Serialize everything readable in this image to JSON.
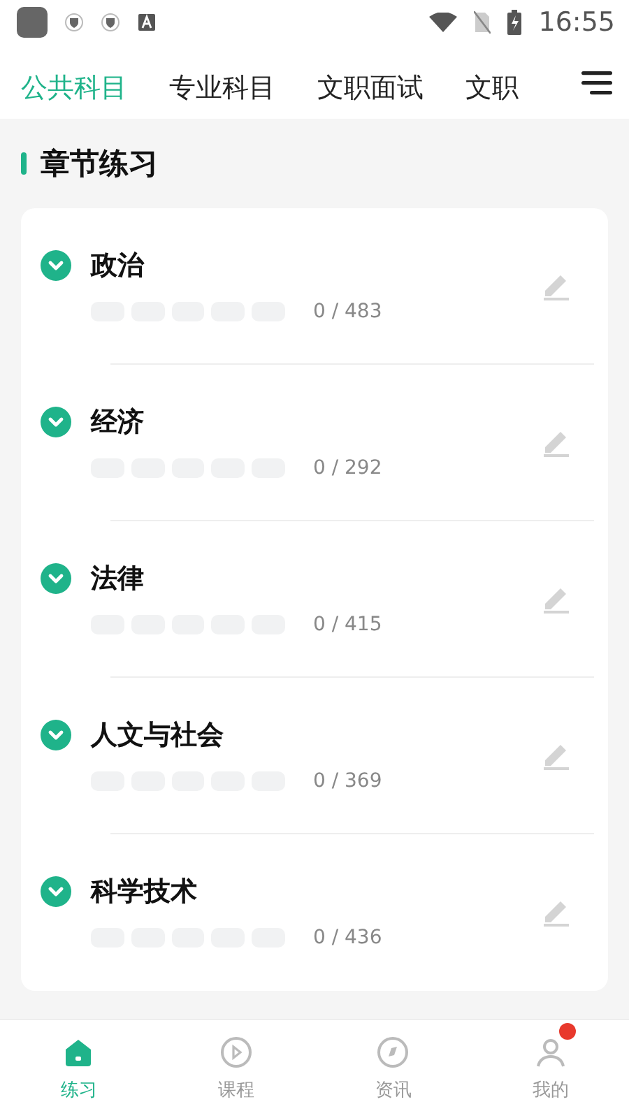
{
  "status_bar": {
    "time": "16:55"
  },
  "tabs": [
    {
      "label": "公共科目",
      "selected": true
    },
    {
      "label": "专业科目",
      "selected": false
    },
    {
      "label": "文职面试",
      "selected": false
    },
    {
      "label": "文职",
      "selected": false
    }
  ],
  "section_title": "章节练习",
  "chapters": [
    {
      "name": "政治",
      "count": "0 / 483"
    },
    {
      "name": "经济",
      "count": "0 / 292"
    },
    {
      "name": "法律",
      "count": "0 / 415"
    },
    {
      "name": "人文与社会",
      "count": "0 / 369"
    },
    {
      "name": "科学技术",
      "count": "0 / 436"
    }
  ],
  "bottom_nav": [
    {
      "label": "练习",
      "selected": true,
      "kind": "home",
      "badge": false
    },
    {
      "label": "课程",
      "selected": false,
      "kind": "play",
      "badge": false
    },
    {
      "label": "资讯",
      "selected": false,
      "kind": "news",
      "badge": false
    },
    {
      "label": "我的",
      "selected": false,
      "kind": "user",
      "badge": true
    }
  ]
}
